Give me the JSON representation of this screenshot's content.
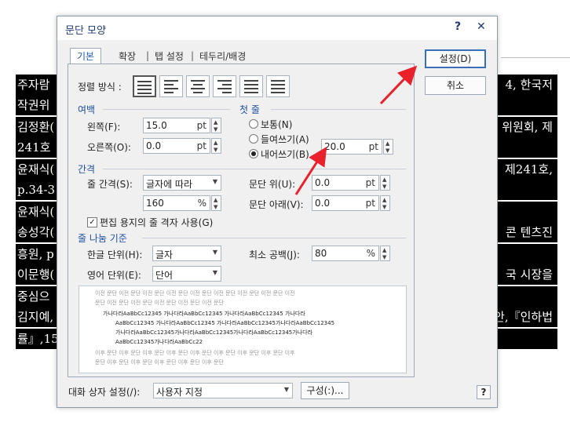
{
  "background_doc": {
    "lines": [
      {
        "left": "주자람",
        "right": "4, 한국저"
      },
      {
        "left": "작권위",
        "right": ""
      },
      {
        "left": "김정환(",
        "right": "위원회, 제"
      },
      {
        "left": "241호",
        "right": ""
      },
      {
        "left": "윤재식(",
        "right": "제241호,"
      },
      {
        "left": "p.34-3",
        "right": ""
      },
      {
        "left": "윤재식(",
        "right": ""
      },
      {
        "left": "송성각(",
        "right": "콘 텐츠진"
      },
      {
        "left": "흥원, p",
        "right": ""
      },
      {
        "left": "이문행(",
        "right": "국 시장을"
      },
      {
        "left": " 중심으",
        "right": ""
      },
      {
        "left": "김지예,",
        "right": "안,『인하법"
      },
      {
        "left": "률』,15(",
        "right": ""
      }
    ]
  },
  "dialog": {
    "title": "문단 모양",
    "help_label": "?",
    "close_label": "✕",
    "tabs": [
      "기본",
      "확장",
      "탭 설정",
      "테두리/배경"
    ],
    "alignment_label": "정렬 방식 :",
    "margin": {
      "section": "여백",
      "left_label": "왼쪽(F):",
      "left_value": "15.0",
      "left_unit": "pt",
      "right_label": "오른쪽(O):",
      "right_value": "0.0",
      "right_unit": "pt"
    },
    "first_line": {
      "section": "첫 줄",
      "normal": "보통(N)",
      "indent": "들여쓰기(A)",
      "hanging": "내어쓰기(B)",
      "selected": "hanging",
      "value": "20.0",
      "unit": "pt"
    },
    "spacing": {
      "section": "간격",
      "line_label": "줄 간격(S):",
      "line_mode": "글자에 따라",
      "line_value": "160",
      "line_unit": "%",
      "above_label": "문단 위(U):",
      "above_value": "0.0",
      "above_unit": "pt",
      "below_label": "문단 아래(V):",
      "below_value": "0.0",
      "below_unit": "pt",
      "grid_label": "편집 용지의 줄 격자 사용(G)",
      "grid_checked": true
    },
    "line_break": {
      "section": "줄 나눔 기준",
      "korean_label": "한글 단위(H):",
      "korean_value": "글자",
      "english_label": "영어 단위(E):",
      "english_value": "단어",
      "min_space_label": "최소 공백(J):",
      "min_space_value": "80",
      "min_space_unit": "%"
    },
    "preview": {
      "before_1": "이전 문단 이전 문단 이전 문단 이전 문단 이전 문단 이전 문단 이전 문단 이전 문단 이전",
      "before_2": "문단 이전 문단 이전 문단 이전 문단 이전 문단 이전 문단",
      "current_1": "가나다라AaBbCc12345      가나다라AaBbCc12345      가나다라AaBbCc12345      가나다라",
      "current_2": "AaBbCc12345  가나다라AaBbCc12345  가나다라AaBbCc12345가나다라AaBbCc12345",
      "current_3": "가나다라AaBbCc12345가나다라AaBbCc12345가나다라AaBbCc12345가나다라",
      "current_4": "AaBbCc12345가나다라AaBbCc22",
      "after_1": "이후 문단 이후 문단 이후 문단 이후 문단 이후 문단 이후 문단 이후 문단 이후 문단 이후",
      "after_2": "문단 이후 문단 이후 문단 이후 문단 이후 문단 이후 문단"
    },
    "ok_label": "설정(D)",
    "cancel_label": "취소",
    "dialog_settings_label": "대화 상자 설정(/):",
    "dialog_settings_value": "사용자 지정",
    "config_label": "구성(:)...",
    "bottom_help": "?"
  },
  "colors": {
    "arrow": "#e8212b",
    "accent": "#1f4fa0",
    "default_button": "#3a6fb8"
  }
}
